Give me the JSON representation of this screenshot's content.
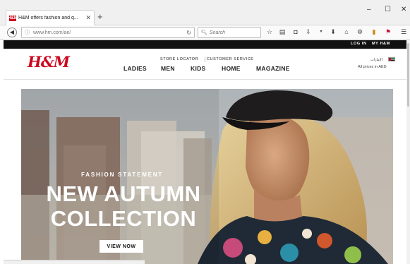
{
  "browser": {
    "tab_title": "H&M offers fashion and q...",
    "favicon_text": "H&M",
    "url": "www.hm.com/ae/",
    "search_placeholder": "Search",
    "toolbar_icons": [
      "star-icon",
      "reading-list-icon",
      "pocket-icon",
      "downloads-icon",
      "download-arrow-icon",
      "home-icon",
      "extension-icon",
      "notes-icon",
      "flag-extension-icon",
      "menu-icon"
    ]
  },
  "site": {
    "topbar": {
      "login": "LOG IN",
      "account": "MY H&M"
    },
    "logo": "H&M",
    "utility_links": [
      "STORE LOCATOR",
      "CUSTOMER SERVICE"
    ],
    "nav": [
      "LADIES",
      "MEN",
      "KIDS",
      "HOME",
      "MAGAZINE"
    ],
    "language": "الإمارات",
    "prices_note": "All prices in AED"
  },
  "hero": {
    "kicker": "FASHION STATEMENT",
    "headline": "NEW AUTUMN COLLECTION",
    "cta": "VIEW NOW"
  },
  "colors": {
    "brand": "#cc071e"
  }
}
